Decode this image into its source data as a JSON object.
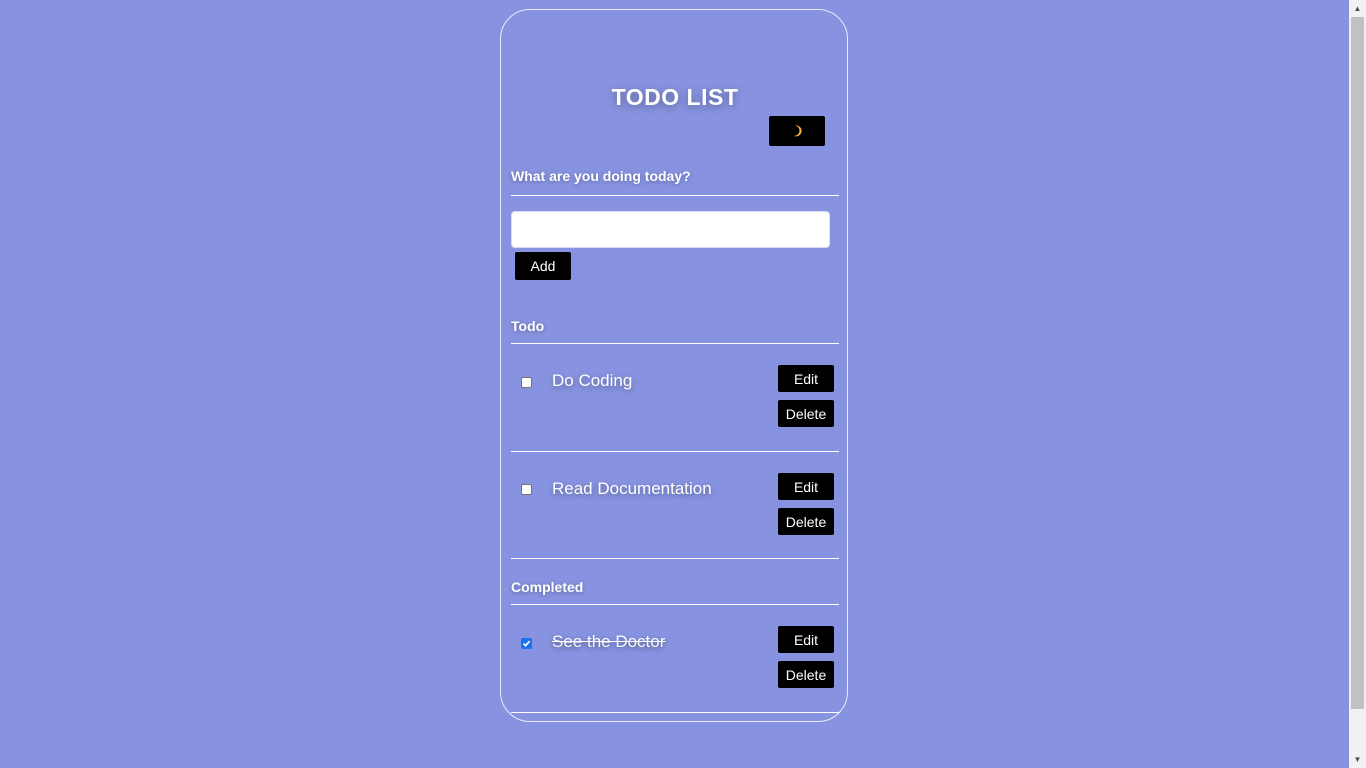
{
  "app": {
    "title": "TODO LIST",
    "theme_toggle_icon": "moon-icon"
  },
  "input_section": {
    "label": "What are you doing today?",
    "input_value": "",
    "input_placeholder": "",
    "add_label": "Add"
  },
  "todo_section": {
    "label": "Todo",
    "items": [
      {
        "text": "Do Coding",
        "checked": false,
        "edit_label": "Edit",
        "delete_label": "Delete"
      },
      {
        "text": "Read Documentation",
        "checked": false,
        "edit_label": "Edit",
        "delete_label": "Delete"
      }
    ]
  },
  "completed_section": {
    "label": "Completed",
    "items": [
      {
        "text": "See the Doctor",
        "checked": true,
        "edit_label": "Edit",
        "delete_label": "Delete"
      }
    ]
  },
  "colors": {
    "background": "#8793e0",
    "button": "#000000",
    "text": "#ffffff",
    "moon": "#f5b82e",
    "checkbox_checked": "#1a73e8"
  }
}
